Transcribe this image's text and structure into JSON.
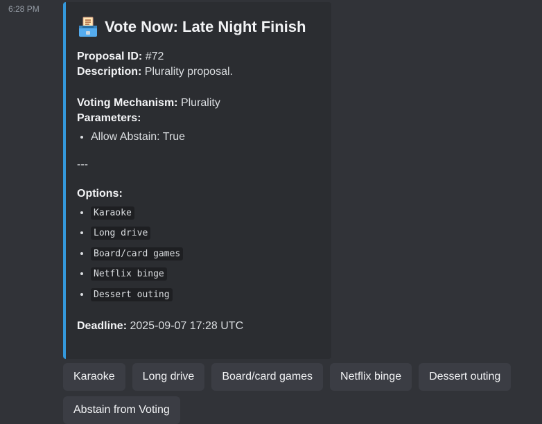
{
  "message": {
    "timestamp": "6:28 PM"
  },
  "embed": {
    "accent_color": "#3498db",
    "title_icon": "ballot-box-icon",
    "title": "Vote Now: Late Night Finish",
    "proposal_id_label": "Proposal ID:",
    "proposal_id_value": "#72",
    "description_label": "Description:",
    "description_value": "Plurality proposal.",
    "mechanism_label": "Voting Mechanism:",
    "mechanism_value": "Plurality",
    "parameters_label": "Parameters:",
    "parameters": [
      "Allow Abstain: True"
    ],
    "separator": "---",
    "options_label": "Options:",
    "options": [
      "Karaoke",
      "Long drive",
      "Board/card games",
      "Netflix binge",
      "Dessert outing"
    ],
    "deadline_label": "Deadline:",
    "deadline_value": "2025-09-07 17:28 UTC"
  },
  "buttons": [
    "Karaoke",
    "Long drive",
    "Board/card games",
    "Netflix binge",
    "Dessert outing",
    "Abstain from Voting"
  ]
}
